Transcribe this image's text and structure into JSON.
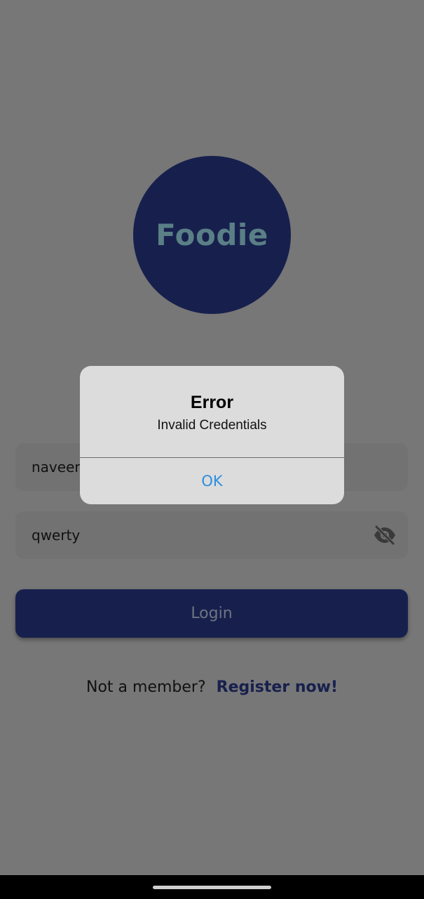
{
  "app": {
    "logo_text": "Foodie"
  },
  "form": {
    "username_value": "naveen",
    "password_value": "qwerty",
    "password_toggle_icon": "eye-off-icon",
    "login_label": "Login"
  },
  "register": {
    "prompt": "Not a member?",
    "link": "Register now!"
  },
  "dialog": {
    "title": "Error",
    "message": "Invalid Credentials",
    "ok_label": "OK"
  },
  "colors": {
    "scrim": "#777777",
    "brand_navy": "#17204d",
    "logo_text": "#5a7f86",
    "dialog_bg": "#dcdcdc",
    "dialog_action": "#2d8fe0"
  }
}
